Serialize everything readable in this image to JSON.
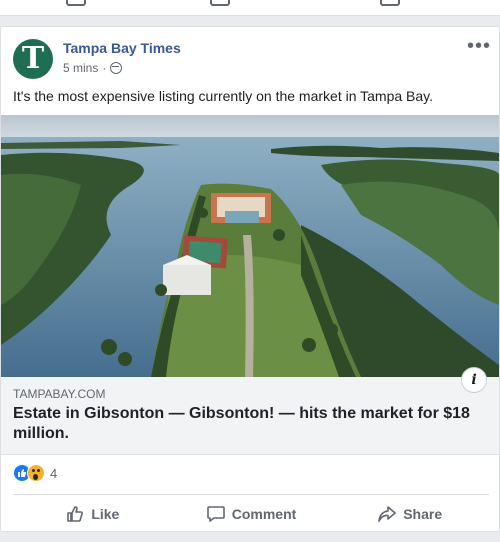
{
  "post": {
    "page_name": "Tampa Bay Times",
    "avatar_letter": "T",
    "time": "5 mins",
    "meta_separator": "·",
    "status_text": "It's the most expensive listing currently on the market in Tampa Bay.",
    "link": {
      "domain": "TAMPABAY.COM",
      "headline": "Estate in Gibsonton — Gibsonton! — hits the market for $18 million."
    },
    "reactions": {
      "types": [
        "like-icon",
        "wow-icon"
      ],
      "count": "4"
    },
    "actions": {
      "like": "Like",
      "comment": "Comment",
      "share": "Share"
    },
    "more_glyph": "•••",
    "info_glyph": "i"
  },
  "colors": {
    "page_name": "#385898",
    "avatar_bg": "#1f6e53",
    "action_text": "#606770"
  }
}
